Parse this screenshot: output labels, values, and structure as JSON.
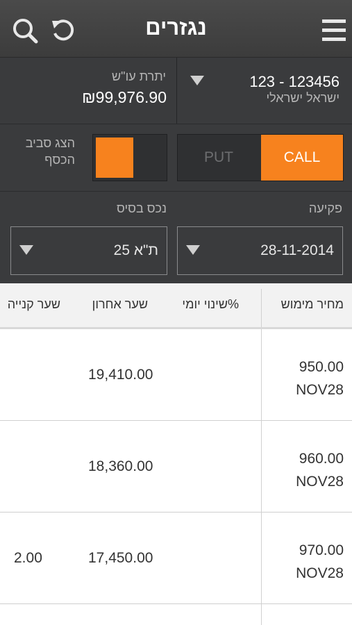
{
  "header": {
    "title": "נגזרים",
    "icons": {
      "menu": "menu-icon",
      "refresh": "refresh-icon",
      "search": "search-icon"
    }
  },
  "account": {
    "number": "123 - 123456",
    "name": "ישראל ישראלי",
    "balance_label": "יתרת עו\"ש",
    "balance_value": "₪99,976.90"
  },
  "options": {
    "call_label": "CALL",
    "put_label": "PUT",
    "selected": "CALL",
    "money_label_line1": "הצג סביב",
    "money_label_line2": "הכסף"
  },
  "filters": {
    "expiry_label": "פקיעה",
    "expiry_value": "28-11-2014",
    "underlying_label": "נכס בסיס",
    "underlying_value": "ת\"א 25"
  },
  "table": {
    "headers": [
      "מחיר מימוש",
      "שינוי יומי%",
      "שער אחרון",
      "שער קנייה"
    ],
    "rows": [
      {
        "strike": "950.00",
        "month": "NOV28",
        "change": "",
        "last": "19,410.00",
        "bid": ""
      },
      {
        "strike": "960.00",
        "month": "NOV28",
        "change": "",
        "last": "18,360.00",
        "bid": ""
      },
      {
        "strike": "970.00",
        "month": "NOV28",
        "change": "",
        "last": "17,450.00",
        "bid": "2.00"
      }
    ]
  },
  "colors": {
    "accent": "#f7821e",
    "panel": "#3a3b3d",
    "header": "#444444"
  }
}
